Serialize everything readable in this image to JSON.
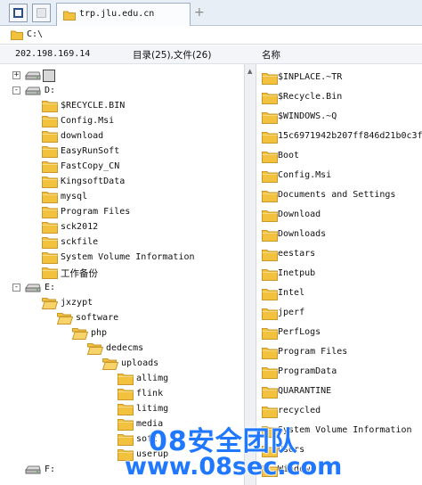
{
  "tab": {
    "title": "trp.jlu.edu.cn",
    "add_label": "+"
  },
  "address": {
    "path": "C:\\"
  },
  "status": {
    "ip": "202.198.169.14",
    "counts": "目录(25),文件(26)",
    "column_name": "名称"
  },
  "tree": [
    {
      "label": "",
      "type": "drive",
      "expander": "+",
      "depth": 0,
      "selected": true
    },
    {
      "label": "D:",
      "type": "drive",
      "expander": "-",
      "depth": 0
    },
    {
      "label": "$RECYCLE.BIN",
      "type": "folder",
      "depth": 1
    },
    {
      "label": "Config.Msi",
      "type": "folder",
      "depth": 1
    },
    {
      "label": "download",
      "type": "folder",
      "depth": 1
    },
    {
      "label": "EasyRunSoft",
      "type": "folder",
      "depth": 1
    },
    {
      "label": "FastCopy_CN",
      "type": "folder",
      "depth": 1
    },
    {
      "label": "KingsoftData",
      "type": "folder",
      "depth": 1
    },
    {
      "label": "mysql",
      "type": "folder",
      "depth": 1
    },
    {
      "label": "Program Files",
      "type": "folder",
      "depth": 1
    },
    {
      "label": "sck2012",
      "type": "folder",
      "depth": 1
    },
    {
      "label": "sckfile",
      "type": "folder",
      "depth": 1
    },
    {
      "label": "System Volume Information",
      "type": "folder",
      "depth": 1
    },
    {
      "label": "工作备份",
      "type": "folder",
      "depth": 1,
      "cjk": true
    },
    {
      "label": "E:",
      "type": "drive",
      "expander": "-",
      "depth": 0
    },
    {
      "label": "jxzypt",
      "type": "folder-open",
      "depth": 1
    },
    {
      "label": "software",
      "type": "folder-open",
      "depth": 2
    },
    {
      "label": "php",
      "type": "folder-open",
      "depth": 3
    },
    {
      "label": "dedecms",
      "type": "folder-open",
      "depth": 4
    },
    {
      "label": "uploads",
      "type": "folder-open",
      "depth": 5
    },
    {
      "label": "allimg",
      "type": "folder",
      "depth": 6
    },
    {
      "label": "flink",
      "type": "folder",
      "depth": 6
    },
    {
      "label": "litimg",
      "type": "folder",
      "depth": 6
    },
    {
      "label": "media",
      "type": "folder",
      "depth": 6
    },
    {
      "label": "soft",
      "type": "folder",
      "depth": 6
    },
    {
      "label": "userup",
      "type": "folder",
      "depth": 6
    },
    {
      "label": "F:",
      "type": "drive",
      "depth": 0
    }
  ],
  "list": [
    "$INPLACE.~TR",
    "$Recycle.Bin",
    "$WINDOWS.~Q",
    "15c6971942b207ff846d21b0c3f",
    "Boot",
    "Config.Msi",
    "Documents and Settings",
    "Download",
    "Downloads",
    "eestars",
    "Inetpub",
    "Intel",
    "jperf",
    "PerfLogs",
    "Program Files",
    "ProgramData",
    "QUARANTINE",
    "recycled",
    "System Volume Information",
    "Users",
    "Windows"
  ],
  "watermark": {
    "line1": "08安全团队",
    "line2": "www.08sec.com"
  },
  "colors": {
    "folder": "#f2c23e",
    "folder_edge": "#c9972a",
    "watermark": "#1f78ff"
  }
}
